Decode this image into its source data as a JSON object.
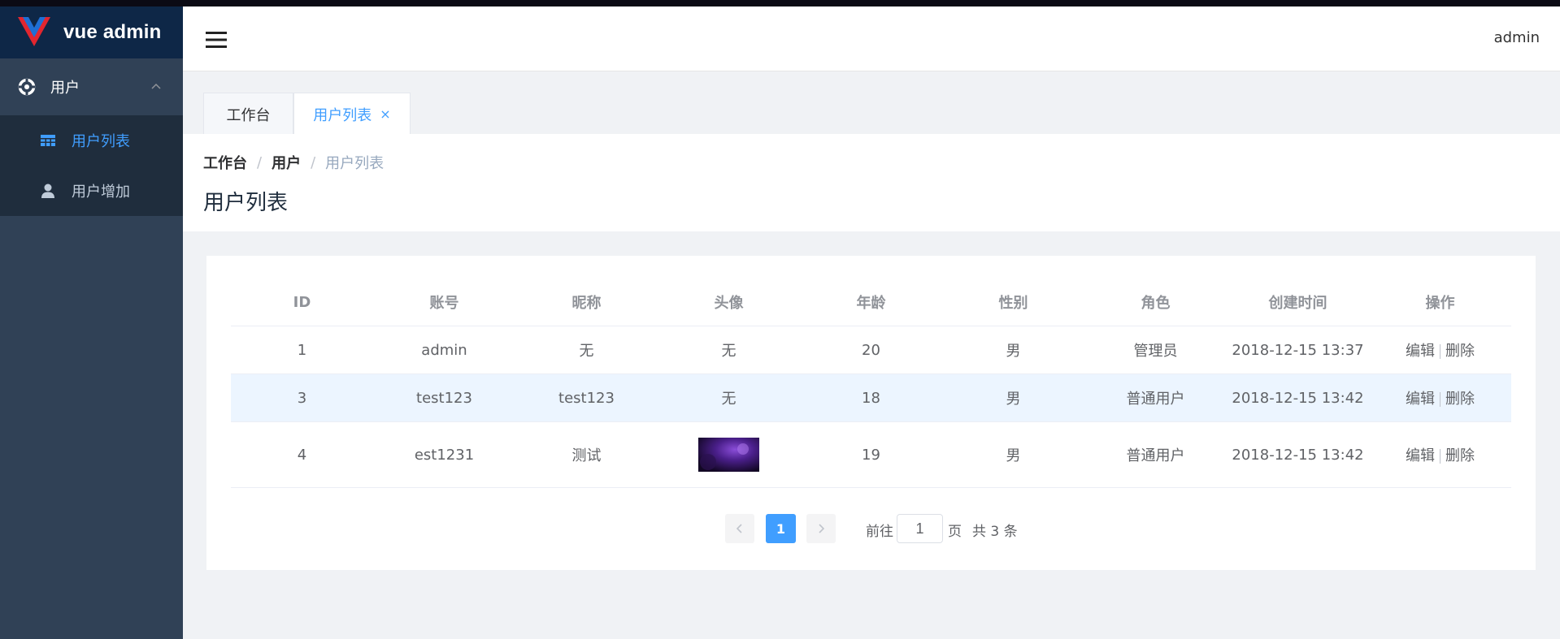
{
  "app": {
    "logo_text": "vue admin"
  },
  "sidebar": {
    "parent_label": "用户",
    "items": [
      {
        "label": "用户列表",
        "active": true
      },
      {
        "label": "用户增加",
        "active": false
      }
    ]
  },
  "header": {
    "username": "admin"
  },
  "tabs": [
    {
      "label": "工作台"
    },
    {
      "label": "用户列表",
      "close": "×"
    }
  ],
  "breadcrumb": {
    "items": [
      "工作台",
      "用户",
      "用户列表"
    ],
    "separator": "/"
  },
  "page": {
    "title": "用户列表"
  },
  "table": {
    "headers": [
      "ID",
      "账号",
      "昵称",
      "头像",
      "年龄",
      "性别",
      "角色",
      "创建时间",
      "操作"
    ],
    "rows": [
      {
        "id": "1",
        "account": "admin",
        "nickname": "无",
        "avatar": "无",
        "age": "20",
        "gender": "男",
        "role": "管理员",
        "created": "2018-12-15 13:37"
      },
      {
        "id": "3",
        "account": "test123",
        "nickname": "test123",
        "avatar": "无",
        "age": "18",
        "gender": "男",
        "role": "普通用户",
        "created": "2018-12-15 13:42"
      },
      {
        "id": "4",
        "account": "est1231",
        "nickname": "测试",
        "avatar": "",
        "age": "19",
        "gender": "男",
        "role": "普通用户",
        "created": "2018-12-15 13:42"
      }
    ],
    "actions": {
      "edit": "编辑",
      "delete": "删除"
    }
  },
  "pagination": {
    "current": "1",
    "goto_label": "前往",
    "goto_value": "1",
    "page_unit": "页",
    "total_text": "共 3 条"
  },
  "colors": {
    "sidebar_bg": "#304156",
    "logo_bg": "#0e2747",
    "submenu_bg": "#1f2d3d",
    "accent": "#409eff",
    "row_highlight": "#ecf5ff"
  }
}
